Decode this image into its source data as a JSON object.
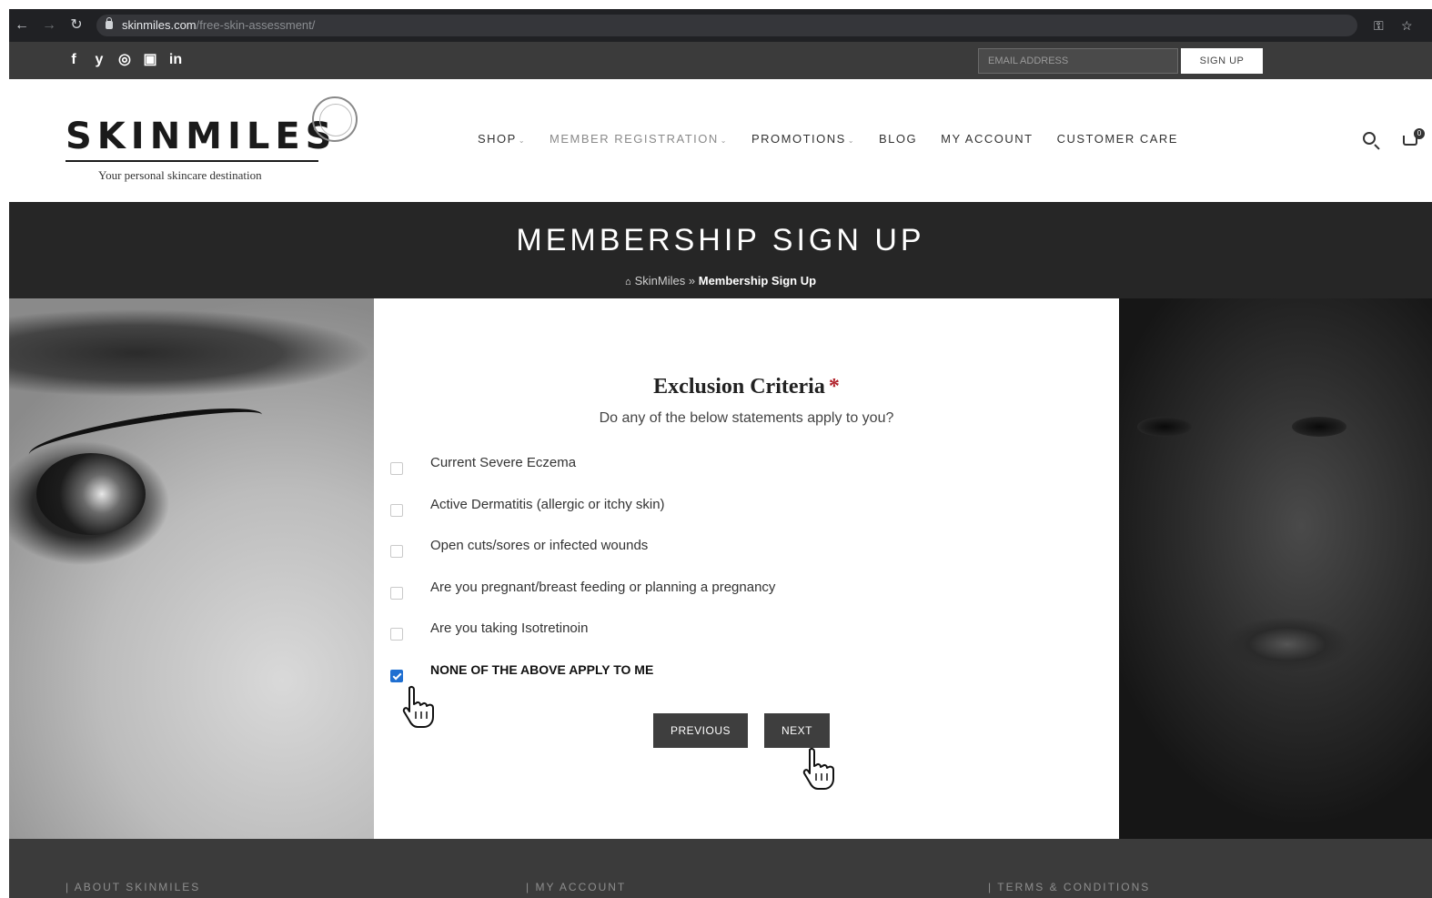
{
  "browser": {
    "url_host": "skinmiles.com",
    "url_path": "/free-skin-assessment/"
  },
  "topbar": {
    "social": [
      "f",
      "y",
      "◎",
      "▣",
      "in"
    ],
    "email_placeholder": "EMAIL ADDRESS",
    "signup_label": "SIGN UP"
  },
  "header": {
    "logo": "SKINMILES",
    "tagline": "Your personal skincare destination",
    "nav": [
      {
        "label": "SHOP",
        "caret": true
      },
      {
        "label": "MEMBER REGISTRATION",
        "caret": true
      },
      {
        "label": "PROMOTIONS",
        "caret": true
      },
      {
        "label": "BLOG",
        "caret": false
      },
      {
        "label": "MY ACCOUNT",
        "caret": false
      },
      {
        "label": "CUSTOMER CARE",
        "caret": false
      }
    ],
    "cart_count": "0"
  },
  "banner": {
    "title": "MEMBERSHIP SIGN UP",
    "breadcrumb_home": "SkinMiles",
    "breadcrumb_sep": "»",
    "breadcrumb_current": "Membership Sign Up"
  },
  "form": {
    "title": "Exclusion Criteria",
    "required_mark": "*",
    "subtitle": "Do any of the below statements apply to you?",
    "options": [
      {
        "label": "Current Severe Eczema",
        "checked": false
      },
      {
        "label": "Active Dermatitis (allergic or itchy skin)",
        "checked": false
      },
      {
        "label": "Open cuts/sores or infected wounds",
        "checked": false
      },
      {
        "label": "Are you pregnant/breast feeding or planning a pregnancy",
        "checked": false
      },
      {
        "label": "Are you taking Isotretinoin",
        "checked": false
      },
      {
        "label": "NONE OF THE ABOVE APPLY TO ME",
        "checked": true
      }
    ],
    "previous_label": "PREVIOUS",
    "next_label": "NEXT"
  },
  "footer": {
    "col1": "| ABOUT SKINMILES",
    "col2": "| MY ACCOUNT",
    "col3": "| TERMS & CONDITIONS"
  },
  "colors": {
    "dark_bg": "#262626",
    "bar_bg": "#3b3b3b",
    "button_bg": "#3e3e3e",
    "required": "#b0212a",
    "checkbox_checked": "#1f6fd1"
  }
}
